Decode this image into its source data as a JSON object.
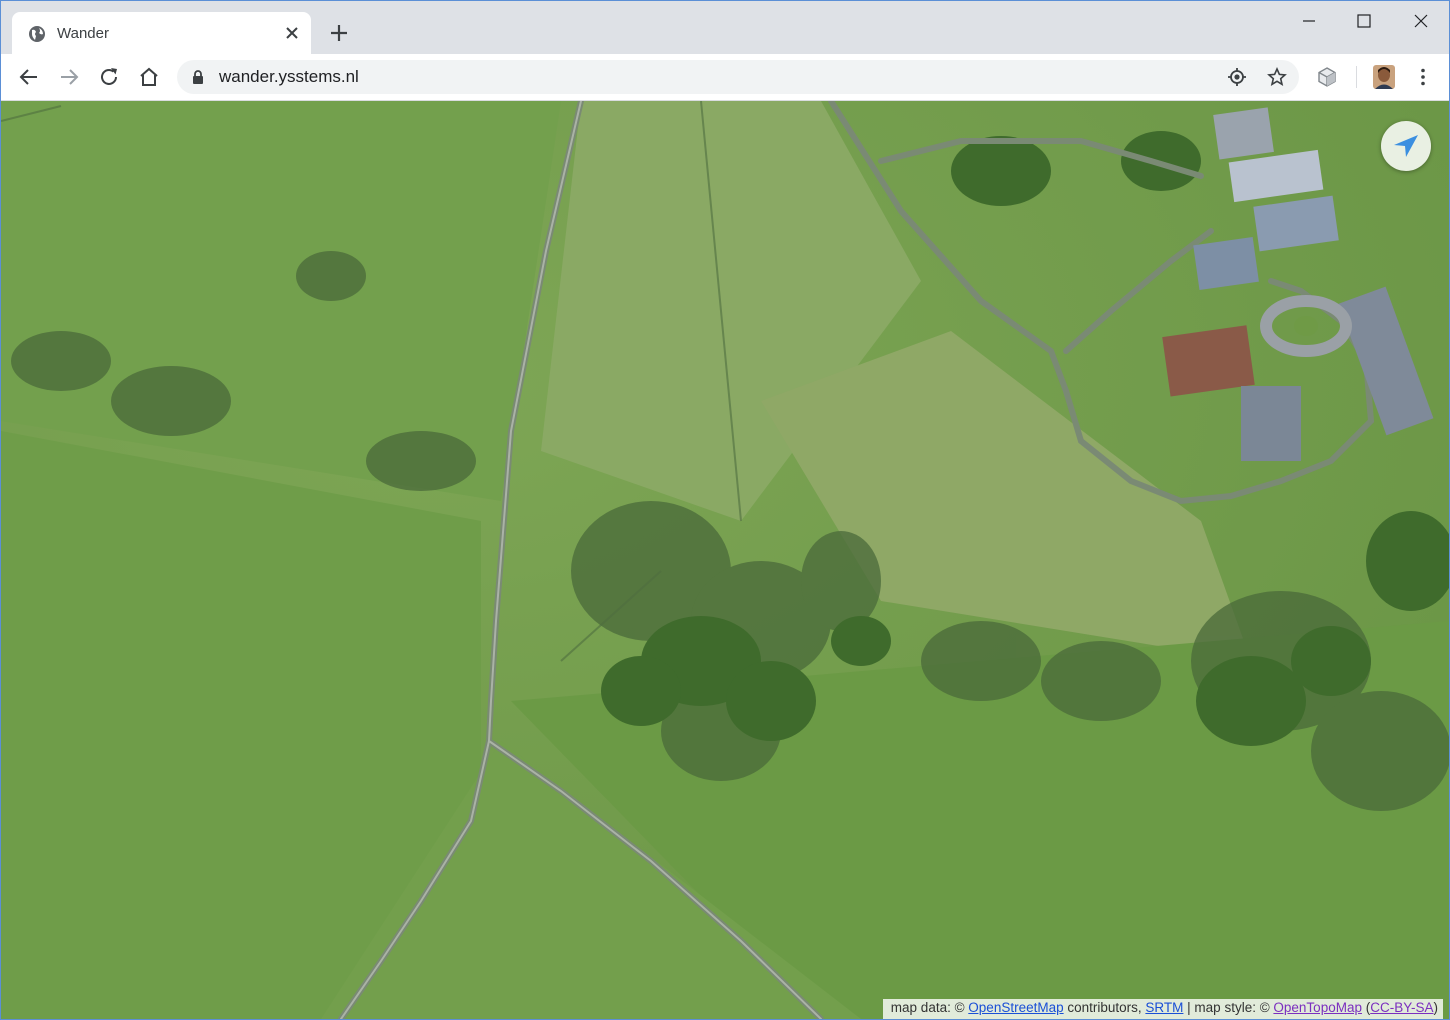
{
  "browser": {
    "tab": {
      "title": "Wander",
      "favicon": "globe-icon"
    },
    "address_bar": {
      "url": "wander.ysstems.nl",
      "security": "lock-icon"
    },
    "toolbar_icons": [
      "back-icon",
      "forward-icon",
      "reload-icon",
      "home-icon",
      "location-icon",
      "star-icon",
      "extension-icon",
      "profile-avatar",
      "menu-icon"
    ],
    "window_controls": [
      "minimize-icon",
      "maximize-icon",
      "close-icon"
    ]
  },
  "map": {
    "type": "satellite aerial imagery",
    "locate_button_icon": "navigation-arrow-icon",
    "accent_color": "#3b8fe0",
    "attribution": {
      "prefix": "map data: © ",
      "osm_link": "OpenStreetMap",
      "mid1": " contributors, ",
      "srtm_link": "SRTM",
      "mid2": " | map style: © ",
      "opentopomap_link": "OpenTopoMap",
      "paren_open": " (",
      "license_link": "CC-BY-SA",
      "paren_close": ")"
    }
  }
}
